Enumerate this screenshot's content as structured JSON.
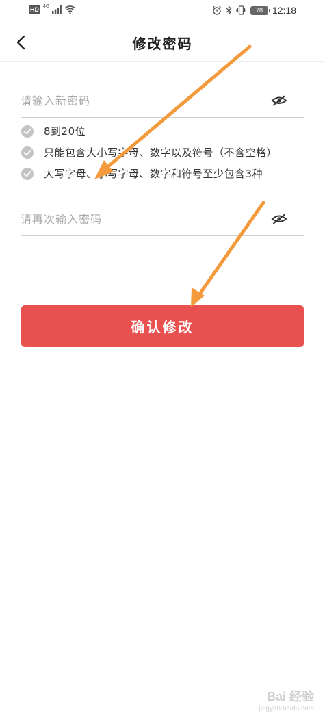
{
  "status_bar": {
    "hd": "HD",
    "network": "4G",
    "battery": "78",
    "time": "12:18"
  },
  "header": {
    "title": "修改密码"
  },
  "new_password": {
    "placeholder": "请输入新密码",
    "value": ""
  },
  "rules": [
    "8到20位",
    "只能包含大小写字母、数字以及符号（不含空格）",
    "大写字母、小写字母、数字和符号至少包含3种"
  ],
  "confirm_password": {
    "placeholder": "请再次输入密码",
    "value": ""
  },
  "confirm_button": {
    "label": "确认修改"
  },
  "watermark": {
    "logo": "Bai 经验",
    "url": "jingyan.baidu.com"
  },
  "colors": {
    "primary_button": "#e8514f",
    "annotation_arrow": "#f39a3c",
    "check_icon": "#c4c4c4",
    "placeholder": "#a8a8a8"
  }
}
